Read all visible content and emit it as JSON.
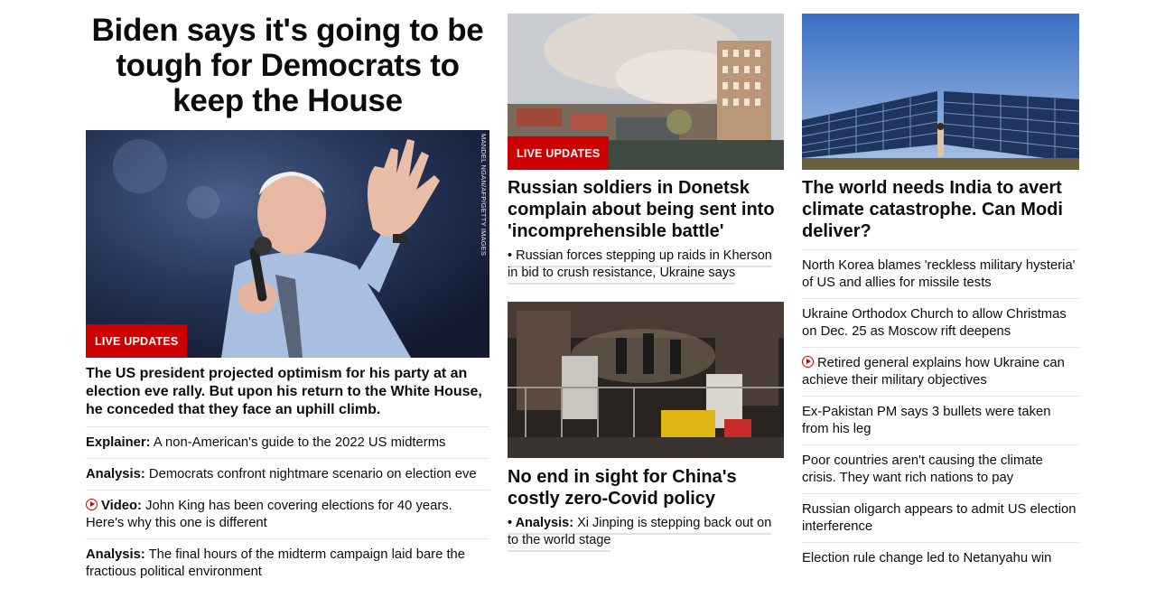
{
  "lead": {
    "headline": "Biden says it's going to be tough for Democrats to keep the House",
    "badge": "LIVE UPDATES",
    "photo_credit": "MANDEL NGAN/AFP/GETTY IMAGES",
    "summary": "The US president projected optimism for his party at an election eve rally. But upon his return to the White House, he conceded that they face an uphill climb.",
    "related": [
      {
        "prefix": "Explainer:",
        "text": " A non-American's guide to the 2022 US midterms",
        "video": false
      },
      {
        "prefix": "Analysis:",
        "text": " Democrats confront nightmare scenario on election eve",
        "video": false
      },
      {
        "prefix": "Video:",
        "text": " John King has been covering elections for 40 years. Here's why this one is different",
        "video": true
      },
      {
        "prefix": "Analysis:",
        "text": " The final hours of the midterm campaign laid bare the fractious political environment",
        "video": false
      }
    ]
  },
  "middle": {
    "story1": {
      "badge": "LIVE UPDATES",
      "title": "Russian soldiers in Donetsk complain about being sent into 'incomprehensible battle'",
      "sub": "• Russian forces stepping up raids in Kherson in bid to crush resistance, Ukraine says"
    },
    "story2": {
      "title": "No end in sight for China's costly zero-Covid policy",
      "sub_prefix": "• Analysis:",
      "sub_text": " Xi Jinping is stepping back out on to the world stage"
    }
  },
  "right": {
    "title": "The world needs India to avert climate catastrophe. Can Modi deliver?",
    "items": [
      {
        "text": "North Korea blames 'reckless military hysteria' of US and allies for missile tests",
        "video": false
      },
      {
        "text": "Ukraine Orthodox Church to allow Christmas on Dec. 25 as Moscow rift deepens",
        "video": false
      },
      {
        "text": "Retired general explains how Ukraine can achieve their military objectives",
        "video": true
      },
      {
        "text": "Ex-Pakistan PM says 3 bullets were taken from his leg",
        "video": false
      },
      {
        "text": "Poor countries aren't causing the climate crisis. They want rich nations to pay",
        "video": false
      },
      {
        "text": "Russian oligarch appears to admit US election interference",
        "video": false
      },
      {
        "text": "Election rule change led to Netanyahu win",
        "video": false
      }
    ]
  }
}
